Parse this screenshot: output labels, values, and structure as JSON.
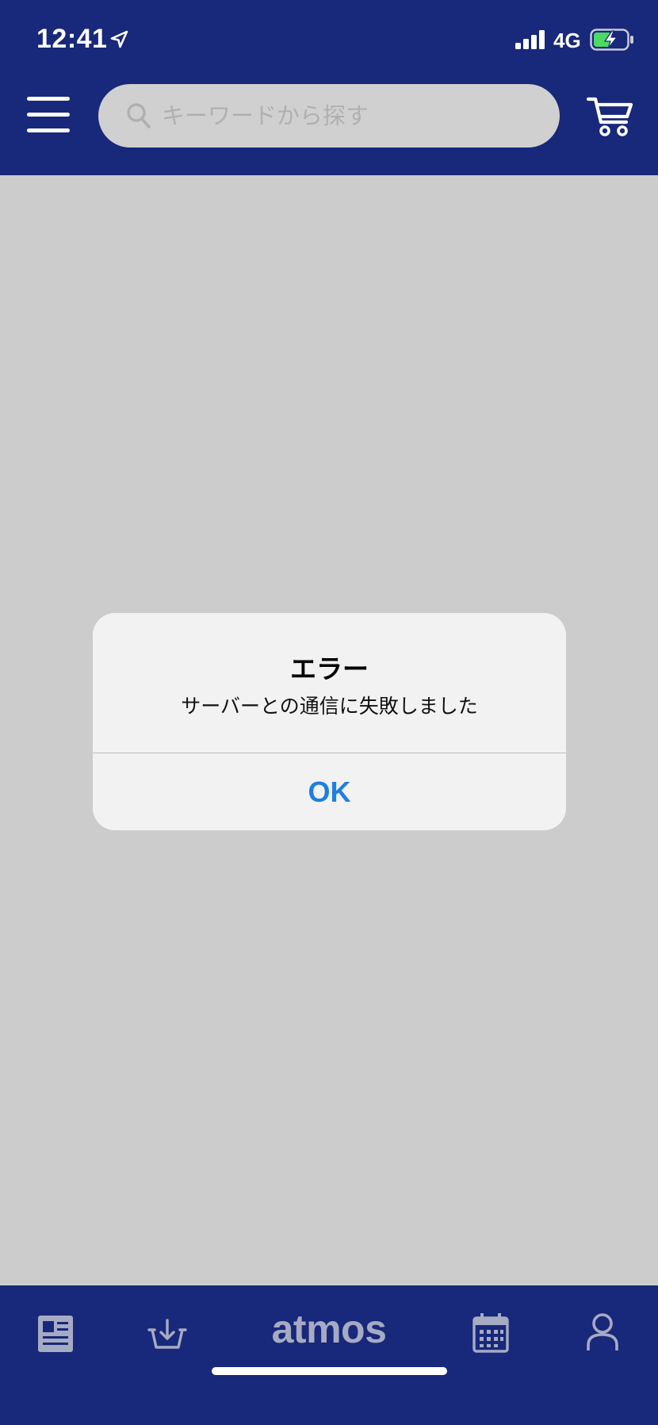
{
  "status_bar": {
    "time": "12:41",
    "network": "4G",
    "location_icon": "location-arrow-icon",
    "signal_icon": "signal-bars-icon",
    "battery_icon": "battery-charging-icon",
    "battery_color": "#4cd964"
  },
  "header": {
    "menu_icon": "hamburger-menu-icon",
    "search": {
      "placeholder": "キーワードから探す",
      "value": ""
    },
    "cart_icon": "shopping-cart-icon",
    "background": "#18287a"
  },
  "dialog": {
    "title": "エラー",
    "message": "サーバーとの通信に失敗しました",
    "ok_label": "OK",
    "ok_color": "#1e7fe0"
  },
  "tabbar": {
    "background": "#18287a",
    "logo_text": "atmos",
    "tabs": [
      {
        "icon": "news-icon"
      },
      {
        "icon": "download-basket-icon"
      },
      {
        "icon": "atmos-logo"
      },
      {
        "icon": "calendar-icon"
      },
      {
        "icon": "account-icon"
      }
    ]
  }
}
